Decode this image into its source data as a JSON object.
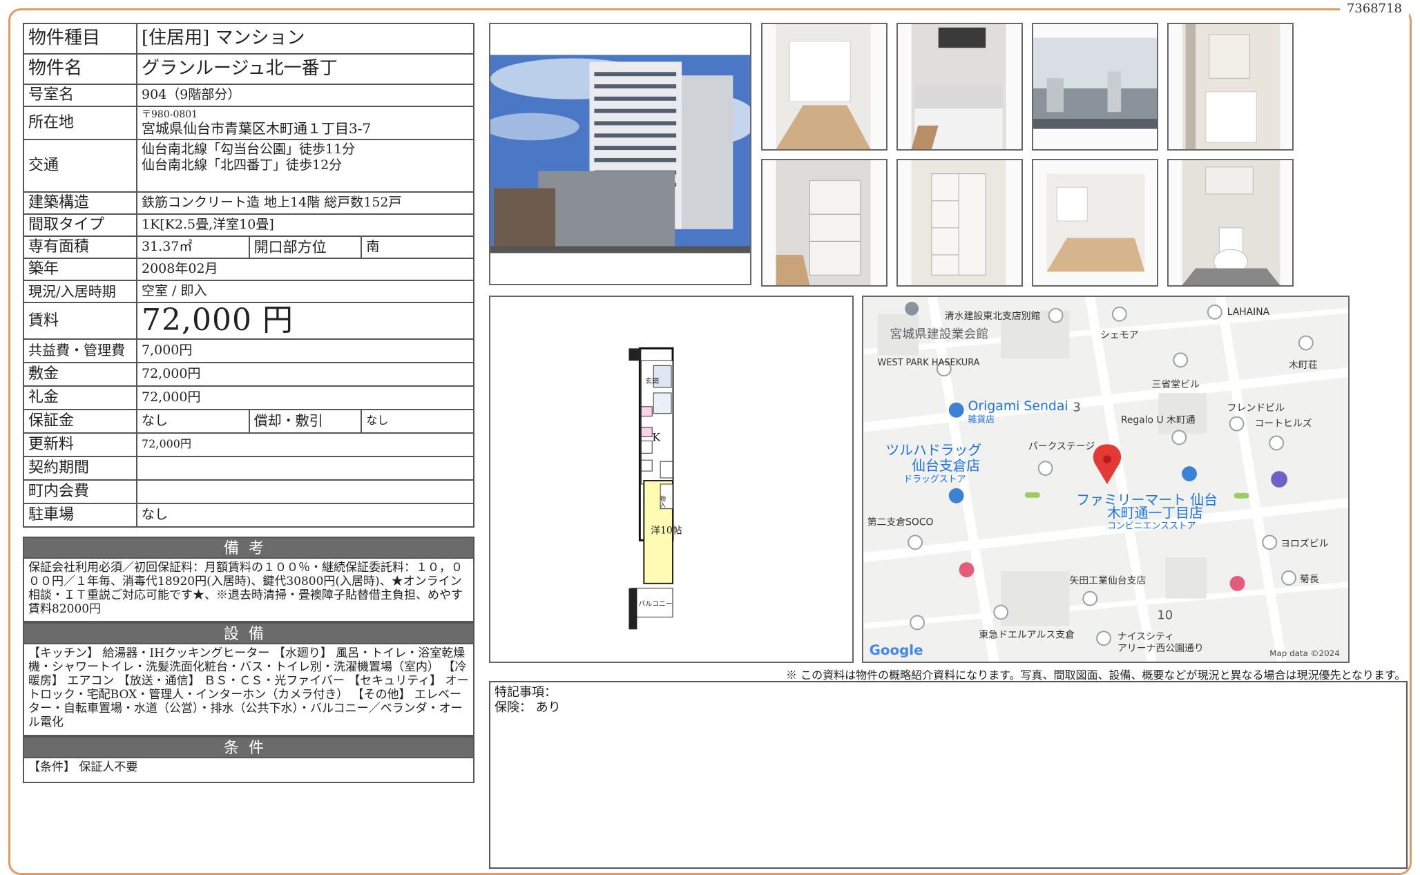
{
  "doc_id": "7368718",
  "spec": {
    "type_label": "物件種目",
    "type_value": "[住居用] マンション",
    "name_label": "物件名",
    "name_value": "グランルージュ北一番丁",
    "room_label": "号室名",
    "room_value": "904（9階部分）",
    "address_label": "所在地",
    "postal": "〒980-0801",
    "address": "宮城県仙台市青葉区木町通１丁目3-7",
    "access_label": "交通",
    "access_1": "仙台南北線「勾当台公園」徒歩11分",
    "access_2": "仙台南北線「北四番丁」徒歩12分",
    "structure_label": "建築構造",
    "structure_value": "鉄筋コンクリート造 地上14階 総戸数152戸",
    "layout_label": "間取タイプ",
    "layout_value": "1K[K2.5畳,洋室10畳]",
    "area_label": "専有面積",
    "area_value": "31.37㎡",
    "facing_label": "開口部方位",
    "facing_value": "南",
    "built_label": "築年",
    "built_value": "2008年02月",
    "status_label": "現況/入居時期",
    "status_value": "空室 / 即入",
    "rent_label": "賃料",
    "rent_value": "72,000 円",
    "fee_label": "共益費・管理費",
    "fee_value": "7,000円",
    "deposit_label": "敷金",
    "deposit_value": "72,000円",
    "key_money_label": "礼金",
    "key_money_value": "72,000円",
    "guarantee_label": "保証金",
    "guarantee_value": "なし",
    "amort_label": "償却・敷引",
    "amort_value": "なし",
    "renewal_label": "更新料",
    "renewal_value": "72,000円",
    "contract_label": "契約期間",
    "contract_value": "",
    "assoc_label": "町内会費",
    "assoc_value": "",
    "parking_label": "駐車場",
    "parking_value": "なし"
  },
  "remarks": {
    "heading": "備考",
    "text": "保証会社利用必須／初回保証料：月額賃料の１００％・継続保証委託料：１０，０００円／１年毎、消毒代18920円(入居時)、鍵代30800円(入居時)、★オンライン相談・ＩＴ重説ご対応可能です★、※退去時清掃・畳襖障子貼替借主負担、めやす賃料82000円"
  },
  "equipment": {
    "heading": "設備",
    "text": "【キッチン】 給湯器・IHクッキングヒーター 【水廻り】 風呂・トイレ・浴室乾燥機・シャワートイレ・洗髪洗面化粧台・バス・トイレ別・洗濯機置場（室内） 【冷暖房】 エアコン 【放送・通信】 ＢＳ・ＣＳ・光ファイバー 【セキュリティ】 オートロック・宅配BOX・管理人・インターホン（カメラ付き） 【その他】 エレベーター・自転車置場・水道（公営）・排水（公共下水）・バルコニー／ベランダ・オール電化"
  },
  "conditions": {
    "heading": "条件",
    "text": "【条件】 保証人不要"
  },
  "floorplan": {
    "entrance": "玄関",
    "kitchen": "K",
    "room": "洋10帖",
    "balcony": "バルコニー",
    "closet": "物入"
  },
  "map": {
    "labels": [
      "清水建設東北支店別館",
      "宮城県建設業会館",
      "シェモア",
      "LAHAINA",
      "WEST PARK HASEKURA",
      "木町荘",
      "三省堂ビル",
      "Origami Sendai",
      "雑貨店",
      "3",
      "フレンドビル",
      "Regalo U 木町通",
      "コートヒルズ",
      "ツルハドラッグ",
      "仙台支倉店",
      "ドラッグストア",
      "パークステージ",
      "ファミリーマート 仙台",
      "木町通一丁目店",
      "コンビニエンスストア",
      "第二支倉SOCO",
      "ヨロズビル",
      "矢田工業仙台支店",
      "菊長",
      "10",
      "東急ドエルアルス支倉",
      "ナイスシティ",
      "アリーナ西公園通り",
      "Google",
      "Map data ©2024"
    ]
  },
  "disclaimer": "※ この資料は物件の概略紹介資料になります。写真、間取図面、設備、概要などが現況と異なる場合は現況優先となります。",
  "notes": {
    "special_label": "特記事項：",
    "insurance": "保険： あり"
  }
}
